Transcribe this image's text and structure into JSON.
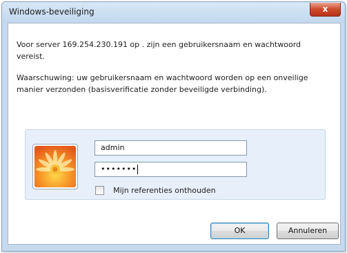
{
  "window": {
    "title": "Windows-beveiliging",
    "close_glyph": "x"
  },
  "message": {
    "line1": "Voor server 169.254.230.191 op . zijn een gebruikersnaam en wachtwoord vereist.",
    "warning": "Waarschuwing: uw gebruikersnaam en wachtwoord worden op een onveilige manier verzonden (basisverificatie zonder beveiligde verbinding)."
  },
  "credentials": {
    "username_value": "admin",
    "password_masked": "•••••••",
    "remember_label": "Mijn referenties onthouden",
    "remember_checked": false,
    "avatar_icon": "flower-user-tile-icon"
  },
  "buttons": {
    "ok_label": "OK",
    "cancel_label": "Annuleren"
  },
  "colors": {
    "titlebar": "#c5d9ef",
    "close_button": "#cf4a2c",
    "panel": "#e6effa"
  }
}
